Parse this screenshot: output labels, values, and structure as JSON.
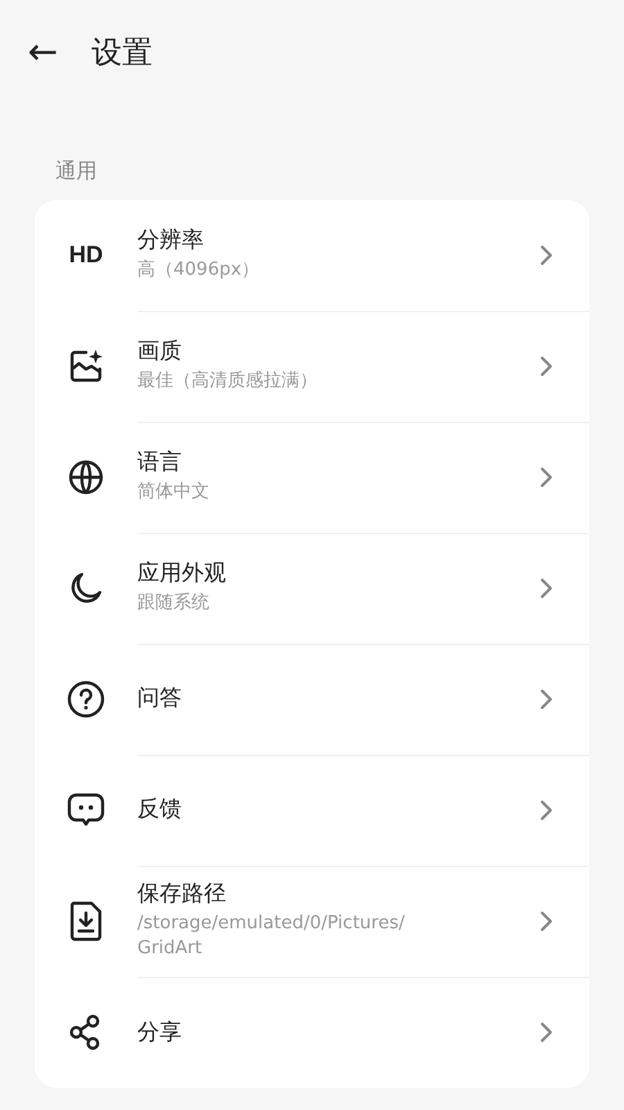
{
  "header": {
    "back": "←",
    "title": "设置"
  },
  "section": {
    "label": "通用"
  },
  "items": [
    {
      "kind": "hd",
      "icon_text": "HD",
      "title": "分辨率",
      "subtitle": [
        "高（4096px）"
      ]
    },
    {
      "kind": "quality",
      "title": "画质",
      "subtitle": [
        "最佳（高清质感拉满）"
      ]
    },
    {
      "kind": "language",
      "title": "语言",
      "subtitle": [
        "简体中文"
      ]
    },
    {
      "kind": "appearance",
      "title": "应用外观",
      "subtitle": [
        "跟随系统"
      ]
    },
    {
      "kind": "faq",
      "title": "问答"
    },
    {
      "kind": "feedback",
      "title": "反馈"
    },
    {
      "kind": "path",
      "title": "保存路径",
      "subtitle": [
        "/storage/emulated/0/Pictures/",
        "GridArt"
      ]
    },
    {
      "kind": "share",
      "title": "分享"
    }
  ]
}
